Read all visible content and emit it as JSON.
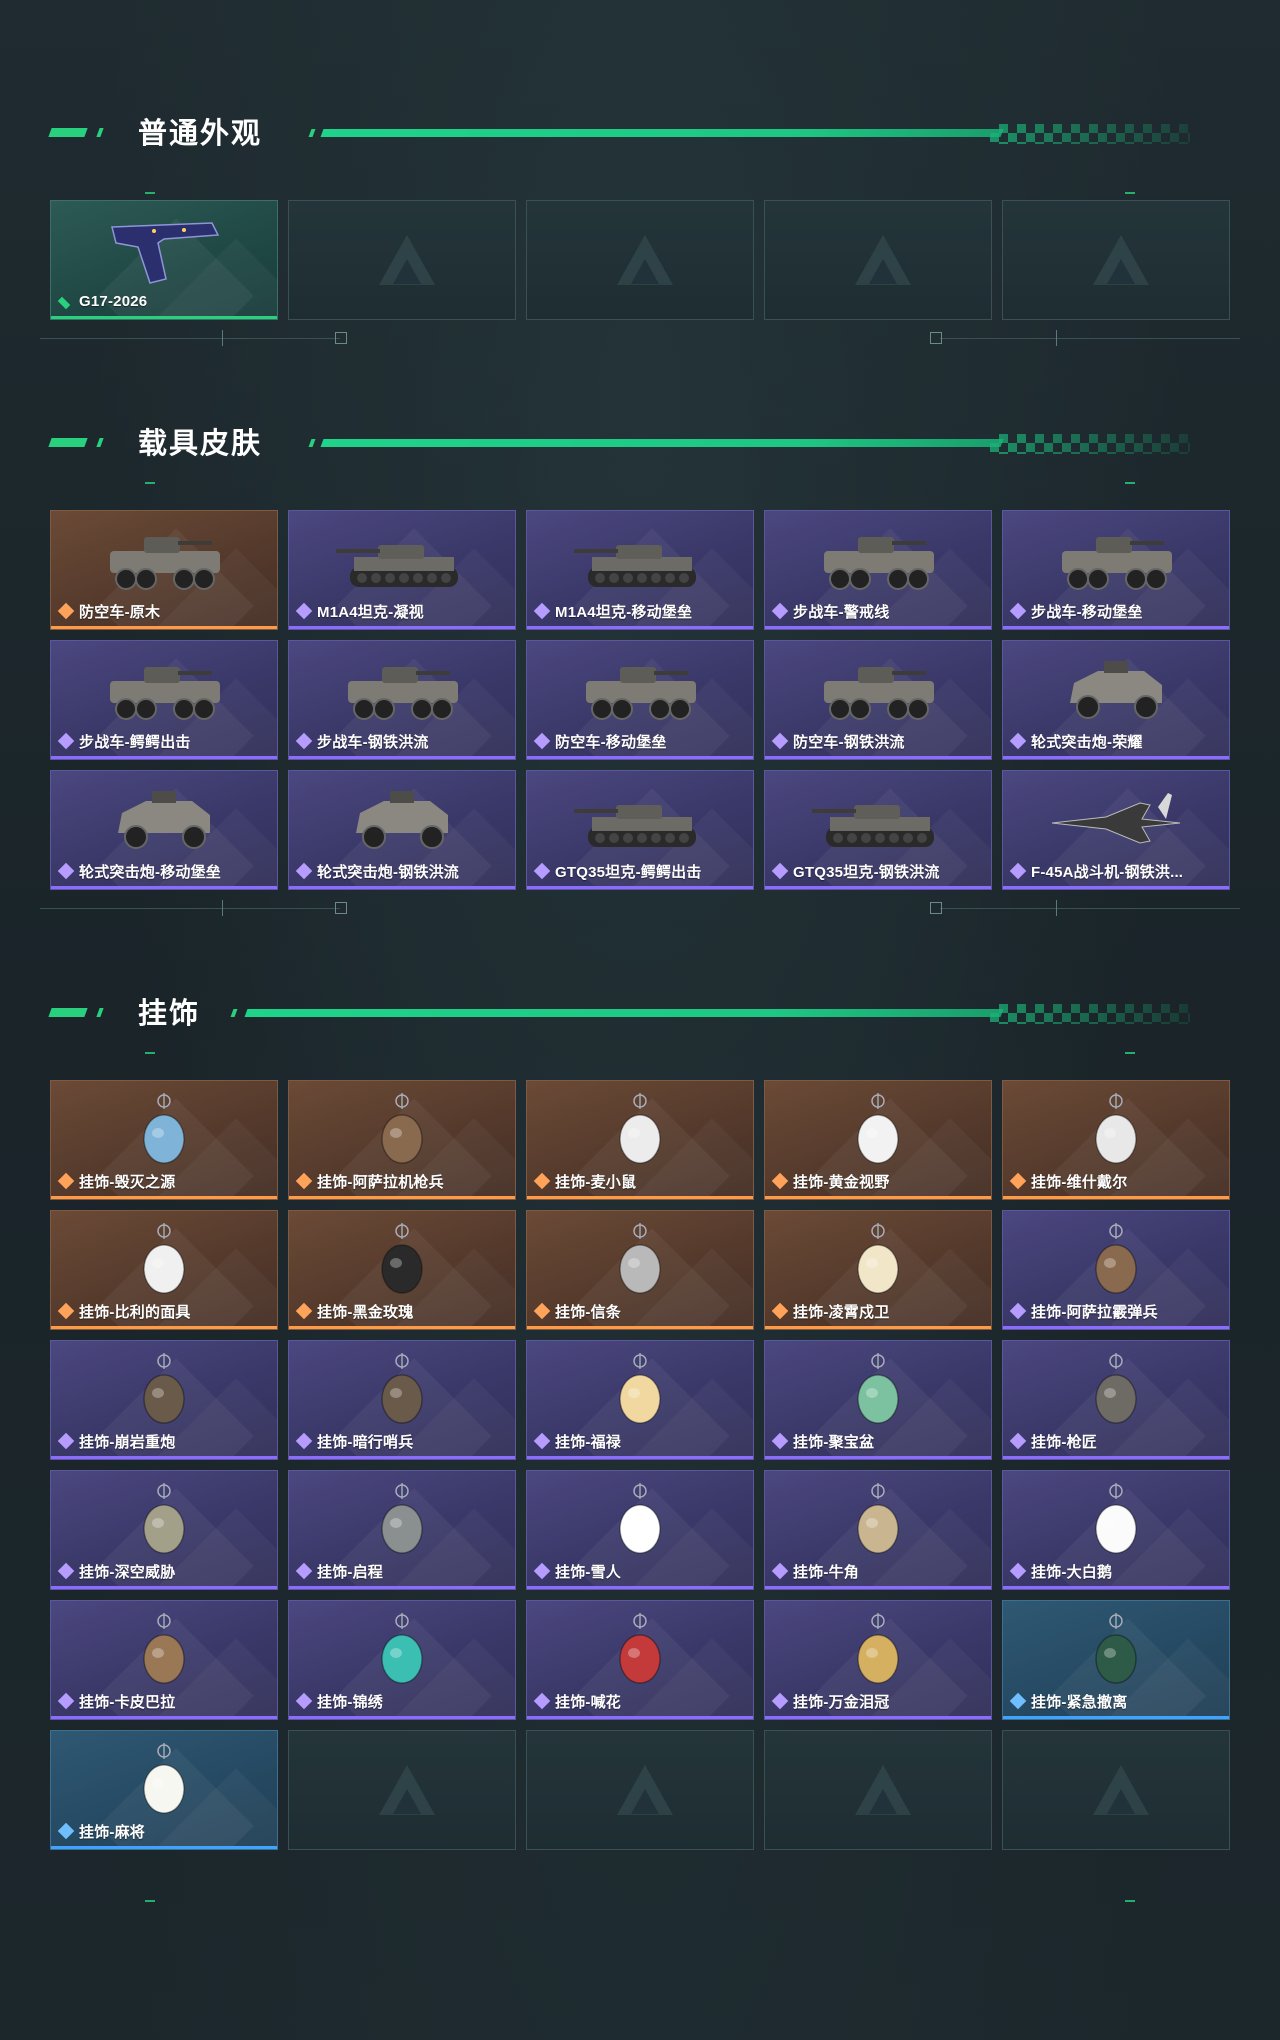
{
  "sections": [
    {
      "title": "普通外观",
      "items": [
        {
          "label": "G17-2026",
          "rarity": "green",
          "icon": "pistol-icon"
        },
        {
          "label": "",
          "rarity": "empty"
        },
        {
          "label": "",
          "rarity": "empty"
        },
        {
          "label": "",
          "rarity": "empty"
        },
        {
          "label": "",
          "rarity": "empty"
        }
      ]
    },
    {
      "title": "载具皮肤",
      "items": [
        {
          "label": "防空车-原木",
          "rarity": "orange",
          "icon": "armored-vehicle-icon"
        },
        {
          "label": "M1A4坦克-凝视",
          "rarity": "purple",
          "icon": "tank-icon"
        },
        {
          "label": "M1A4坦克-移动堡垒",
          "rarity": "purple",
          "icon": "tank-icon"
        },
        {
          "label": "步战车-警戒线",
          "rarity": "purple",
          "icon": "armored-vehicle-icon"
        },
        {
          "label": "步战车-移动堡垒",
          "rarity": "purple",
          "icon": "armored-vehicle-icon"
        },
        {
          "label": "步战车-鳄鳄出击",
          "rarity": "purple",
          "icon": "armored-vehicle-icon"
        },
        {
          "label": "步战车-钢铁洪流",
          "rarity": "purple",
          "icon": "armored-vehicle-icon"
        },
        {
          "label": "防空车-移动堡垒",
          "rarity": "purple",
          "icon": "armored-vehicle-icon"
        },
        {
          "label": "防空车-钢铁洪流",
          "rarity": "purple",
          "icon": "armored-vehicle-icon"
        },
        {
          "label": "轮式突击炮-荣耀",
          "rarity": "purple",
          "icon": "light-vehicle-icon"
        },
        {
          "label": "轮式突击炮-移动堡垒",
          "rarity": "purple",
          "icon": "light-vehicle-icon"
        },
        {
          "label": "轮式突击炮-钢铁洪流",
          "rarity": "purple",
          "icon": "light-vehicle-icon"
        },
        {
          "label": "GTQ35坦克-鳄鳄出击",
          "rarity": "purple",
          "icon": "tank-icon"
        },
        {
          "label": "GTQ35坦克-钢铁洪流",
          "rarity": "purple",
          "icon": "tank-icon"
        },
        {
          "label": "F-45A战斗机-钢铁洪...",
          "rarity": "purple",
          "icon": "jet-icon"
        }
      ]
    },
    {
      "title": "挂饰",
      "items": [
        {
          "label": "挂饰-毁灭之源",
          "rarity": "orange",
          "icon": "dragon-charm-icon"
        },
        {
          "label": "挂饰-阿萨拉机枪兵",
          "rarity": "orange",
          "icon": "soldier-charm-icon"
        },
        {
          "label": "挂饰-麦小鼠",
          "rarity": "orange",
          "icon": "mouse-charm-icon"
        },
        {
          "label": "挂饰-黄金视野",
          "rarity": "orange",
          "icon": "cat-charm-icon"
        },
        {
          "label": "挂饰-维什戴尔",
          "rarity": "orange",
          "icon": "tag-charm-icon"
        },
        {
          "label": "挂饰-比利的面具",
          "rarity": "orange",
          "icon": "mask-charm-icon"
        },
        {
          "label": "挂饰-黑金玫瑰",
          "rarity": "orange",
          "icon": "rose-charm-icon"
        },
        {
          "label": "挂饰-信条",
          "rarity": "orange",
          "icon": "blade-charm-icon"
        },
        {
          "label": "挂饰-凌霄戍卫",
          "rarity": "orange",
          "icon": "duck-charm-icon"
        },
        {
          "label": "挂饰-阿萨拉霰弹兵",
          "rarity": "purple",
          "icon": "soldier-charm-icon"
        },
        {
          "label": "挂饰-崩岩重炮",
          "rarity": "purple",
          "icon": "figure-charm-icon"
        },
        {
          "label": "挂饰-暗行哨兵",
          "rarity": "purple",
          "icon": "figure-charm-icon"
        },
        {
          "label": "挂饰-福禄",
          "rarity": "purple",
          "icon": "gourd-charm-icon"
        },
        {
          "label": "挂饰-聚宝盆",
          "rarity": "purple",
          "icon": "treasure-bowl-charm-icon"
        },
        {
          "label": "挂饰-枪匠",
          "rarity": "purple",
          "icon": "box-charm-icon"
        },
        {
          "label": "挂饰-深空威胁",
          "rarity": "purple",
          "icon": "device-charm-icon"
        },
        {
          "label": "挂饰-启程",
          "rarity": "purple",
          "icon": "ring-charm-icon"
        },
        {
          "label": "挂饰-雪人",
          "rarity": "purple",
          "icon": "snowman-charm-icon"
        },
        {
          "label": "挂饰-牛角",
          "rarity": "purple",
          "icon": "horns-charm-icon"
        },
        {
          "label": "挂饰-大白鹅",
          "rarity": "purple",
          "icon": "goose-charm-icon"
        },
        {
          "label": "挂饰-卡皮巴拉",
          "rarity": "purple",
          "icon": "capybara-charm-icon"
        },
        {
          "label": "挂饰-锦绣",
          "rarity": "purple",
          "icon": "butterfly-charm-icon"
        },
        {
          "label": "挂饰-喊花",
          "rarity": "purple",
          "icon": "flower-charm-icon"
        },
        {
          "label": "挂饰-万金泪冠",
          "rarity": "purple",
          "icon": "crown-charm-icon"
        },
        {
          "label": "挂饰-紧急撤离",
          "rarity": "blue",
          "icon": "sign-charm-icon"
        },
        {
          "label": "挂饰-麻将",
          "rarity": "blue",
          "icon": "mahjong-charm-icon"
        },
        {
          "label": "",
          "rarity": "empty"
        },
        {
          "label": "",
          "rarity": "empty"
        },
        {
          "label": "",
          "rarity": "empty"
        },
        {
          "label": "",
          "rarity": "empty"
        }
      ]
    }
  ],
  "colors": {
    "accent": "#29d17e",
    "rarity_green": "#29d17e",
    "rarity_purple": "#8b6cff",
    "rarity_orange": "#ff9b47",
    "rarity_blue": "#3ea4ff"
  }
}
